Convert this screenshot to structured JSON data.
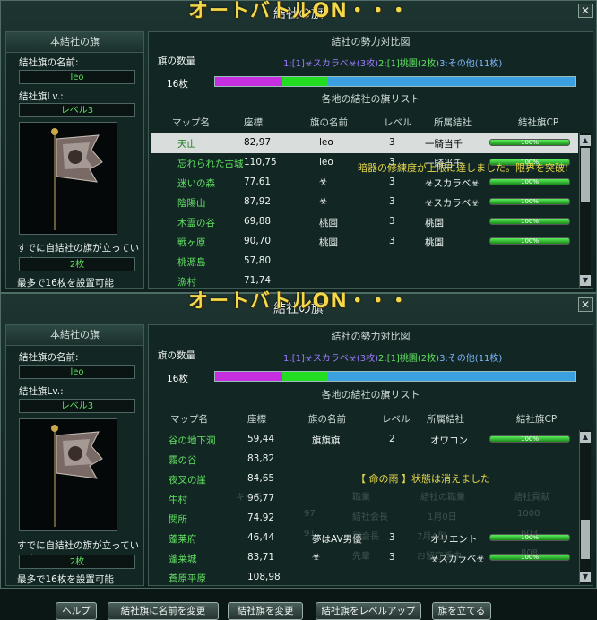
{
  "overlay_text": "オートバトルON・・・",
  "window": {
    "title": "結社の旗",
    "close_icon": "close-icon"
  },
  "left_panel": {
    "header": "本結社の旗",
    "name_label": "結社旗の名前:",
    "name_value": "leo",
    "level_label": "結社旗Lv.:",
    "level_value": "レベル3",
    "status_text": "すでに自結社の旗が立っています",
    "count_value": "2枚",
    "max_text": "最多で16枚を設置可能"
  },
  "right_panel": {
    "header": "結社の勢力対比図",
    "flag_count_label": "旗の数量",
    "legend": {
      "p1": "1:[1]☣スカラベ☣(3枚)",
      "p2": "2:[1]桃園(2枚)",
      "p3": "3:その他(11枚)"
    },
    "count": "16枚",
    "bar_shares": [
      3,
      2,
      11
    ],
    "bar_colors": [
      "#c62fe0",
      "#22dd22",
      "#3aa0e0"
    ],
    "list_title": "各地の結社の旗リスト",
    "columns": [
      "マップ名",
      "座標",
      "旗の名前",
      "レベル",
      "所属結社",
      "結社旗CP"
    ]
  },
  "top_rows": [
    {
      "map": "天山",
      "coord": "82,97",
      "flag": "leo",
      "level": "3",
      "guild": "一騎当千",
      "cp": "100%",
      "selected": true
    },
    {
      "map": "忘れられた古城",
      "coord": "110,75",
      "flag": "leo",
      "level": "3",
      "guild": "一騎当千",
      "cp": "100%",
      "selected": false
    },
    {
      "map": "迷いの森",
      "coord": "77,61",
      "flag": "☣",
      "level": "3",
      "guild": "☣スカラベ☣",
      "cp": "100%",
      "selected": false
    },
    {
      "map": "陰陽山",
      "coord": "87,92",
      "flag": "☣",
      "level": "3",
      "guild": "☣スカラベ☣",
      "cp": "100%",
      "selected": false
    },
    {
      "map": "木霊の谷",
      "coord": "69,88",
      "flag": "桃園",
      "level": "3",
      "guild": "桃園",
      "cp": "100%",
      "selected": false
    },
    {
      "map": "戦ヶ原",
      "coord": "90,70",
      "flag": "桃園",
      "level": "3",
      "guild": "桃園",
      "cp": "100%",
      "selected": false
    },
    {
      "map": "桃源島",
      "coord": "57,80",
      "flag": "",
      "level": "",
      "guild": "",
      "cp": "",
      "selected": false
    },
    {
      "map": "漁村",
      "coord": "71,74",
      "flag": "",
      "level": "",
      "guild": "",
      "cp": "",
      "selected": false
    }
  ],
  "bottom_rows": [
    {
      "map": "谷の地下洞",
      "coord": "59,44",
      "flag": "旗旗旗",
      "level": "2",
      "guild": "オワコン",
      "cp": "100%"
    },
    {
      "map": "霧の谷",
      "coord": "83,82",
      "flag": "",
      "level": "",
      "guild": "",
      "cp": ""
    },
    {
      "map": "夜叉の崖",
      "coord": "84,65",
      "flag": "",
      "level": "",
      "guild": "",
      "cp": ""
    },
    {
      "map": "牛村",
      "coord": "96,77",
      "flag": "",
      "level": "",
      "guild": "",
      "cp": ""
    },
    {
      "map": "関所",
      "coord": "74,92",
      "flag": "",
      "level": "",
      "guild": "",
      "cp": ""
    },
    {
      "map": "蓬莱府",
      "coord": "46,44",
      "flag": "夢はAV男優",
      "level": "3",
      "guild": "オリエント",
      "cp": "100%"
    },
    {
      "map": "蓬莱城",
      "coord": "83,71",
      "flag": "☣",
      "level": "3",
      "guild": "☣スカラベ☣",
      "cp": "100%"
    },
    {
      "map": "蒼原平原",
      "coord": "108,98",
      "flag": "",
      "level": "",
      "guild": "",
      "cp": ""
    }
  ],
  "messages": {
    "top": "暗器の修練度が上限に達しました。限界を突破!",
    "bottom": "【 命の雨 】状態は消えました"
  },
  "ghost_text": {
    "a": "キャラ",
    "b": "職業",
    "c": "ランク",
    "d": "97",
    "e": "結社会長",
    "f": "1月0日",
    "g": "91",
    "h": "副会長",
    "i": "特技",
    "j": "先輩",
    "k": "お留守番中",
    "l": "1000",
    "m": "603",
    "n": "808",
    "o": "7月A型",
    "p": "結社貢献",
    "q": "結社の職業",
    "r": "ニック"
  },
  "buttons": {
    "help": "ヘルプ",
    "rename": "結社旗に名前を変更",
    "change": "結社旗を変更",
    "levelup": "結社旗をレベルアップ",
    "raise": "旗を立てる"
  },
  "colors": {
    "map_green": "#62e062",
    "accent_green": "#5fe05f",
    "legend_purple": "#9a7cff",
    "message_yellow": "#e8d84a"
  }
}
